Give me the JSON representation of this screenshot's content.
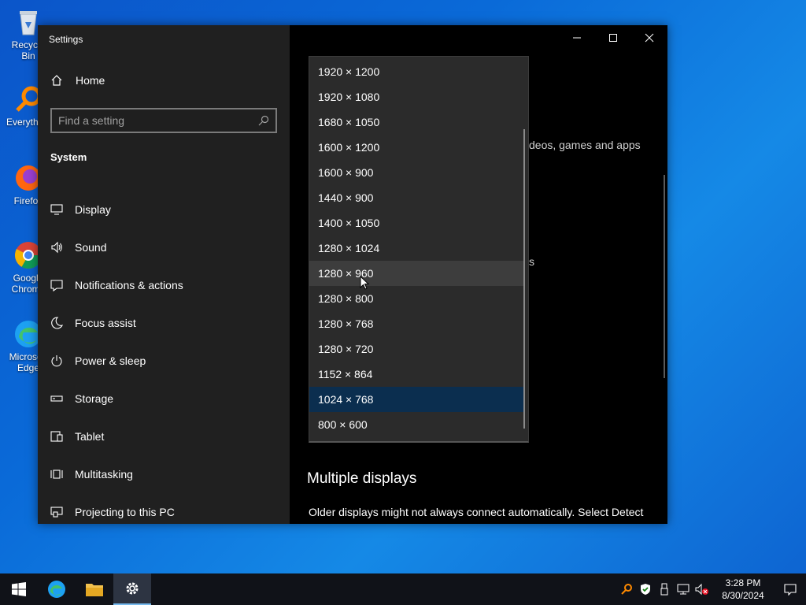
{
  "desktop": {
    "icons": [
      {
        "label": "Recycle Bin",
        "icon": "recycle-bin-icon"
      },
      {
        "label": "Everything",
        "icon": "everything-search-icon"
      },
      {
        "label": "Firefox",
        "icon": "firefox-icon"
      },
      {
        "label": "Google Chrome",
        "icon": "chrome-icon"
      },
      {
        "label": "Microsoft Edge",
        "icon": "edge-icon"
      }
    ]
  },
  "window": {
    "title": "Settings",
    "controls": {
      "minimize": "minimize-icon",
      "maximize": "maximize-icon",
      "close": "close-icon"
    }
  },
  "sidebar": {
    "home_label": "Home",
    "search_placeholder": "Find a setting",
    "section_title": "System",
    "items": [
      {
        "label": "Display",
        "icon": "display-icon"
      },
      {
        "label": "Sound",
        "icon": "sound-icon"
      },
      {
        "label": "Notifications & actions",
        "icon": "notifications-icon"
      },
      {
        "label": "Focus assist",
        "icon": "moon-icon"
      },
      {
        "label": "Power & sleep",
        "icon": "power-icon"
      },
      {
        "label": "Storage",
        "icon": "storage-icon"
      },
      {
        "label": "Tablet",
        "icon": "tablet-icon"
      },
      {
        "label": "Multitasking",
        "icon": "multitasking-icon"
      },
      {
        "label": "Projecting to this PC",
        "icon": "projecting-icon"
      }
    ]
  },
  "content": {
    "partial_text_1": "deos, games and apps",
    "partial_text_2": "s",
    "section_heading": "Multiple displays",
    "section_body": "Older displays might not always connect automatically. Select Detect"
  },
  "resolution_dropdown": {
    "options": [
      "1920 × 1200",
      "1920 × 1080",
      "1680 × 1050",
      "1600 × 1200",
      "1600 × 900",
      "1440 × 900",
      "1400 × 1050",
      "1280 × 1024",
      "1280 × 960",
      "1280 × 800",
      "1280 × 768",
      "1280 × 720",
      "1152 × 864",
      "1024 × 768",
      "800 × 600"
    ],
    "hovered": "1280 × 960",
    "selected": "1024 × 768"
  },
  "taskbar": {
    "pinned": [
      {
        "name": "start",
        "icon": "windows-start-icon"
      },
      {
        "name": "edge",
        "icon": "edge-icon"
      },
      {
        "name": "file-explorer",
        "icon": "folder-icon"
      },
      {
        "name": "settings",
        "icon": "gear-icon",
        "active": true
      }
    ],
    "tray_icons": [
      "everything-search-icon",
      "security-shield-icon",
      "usb-icon",
      "network-icon",
      "volume-muted-icon"
    ],
    "time": "3:28 PM",
    "date": "8/30/2024",
    "notification_icon": "action-center-icon"
  }
}
